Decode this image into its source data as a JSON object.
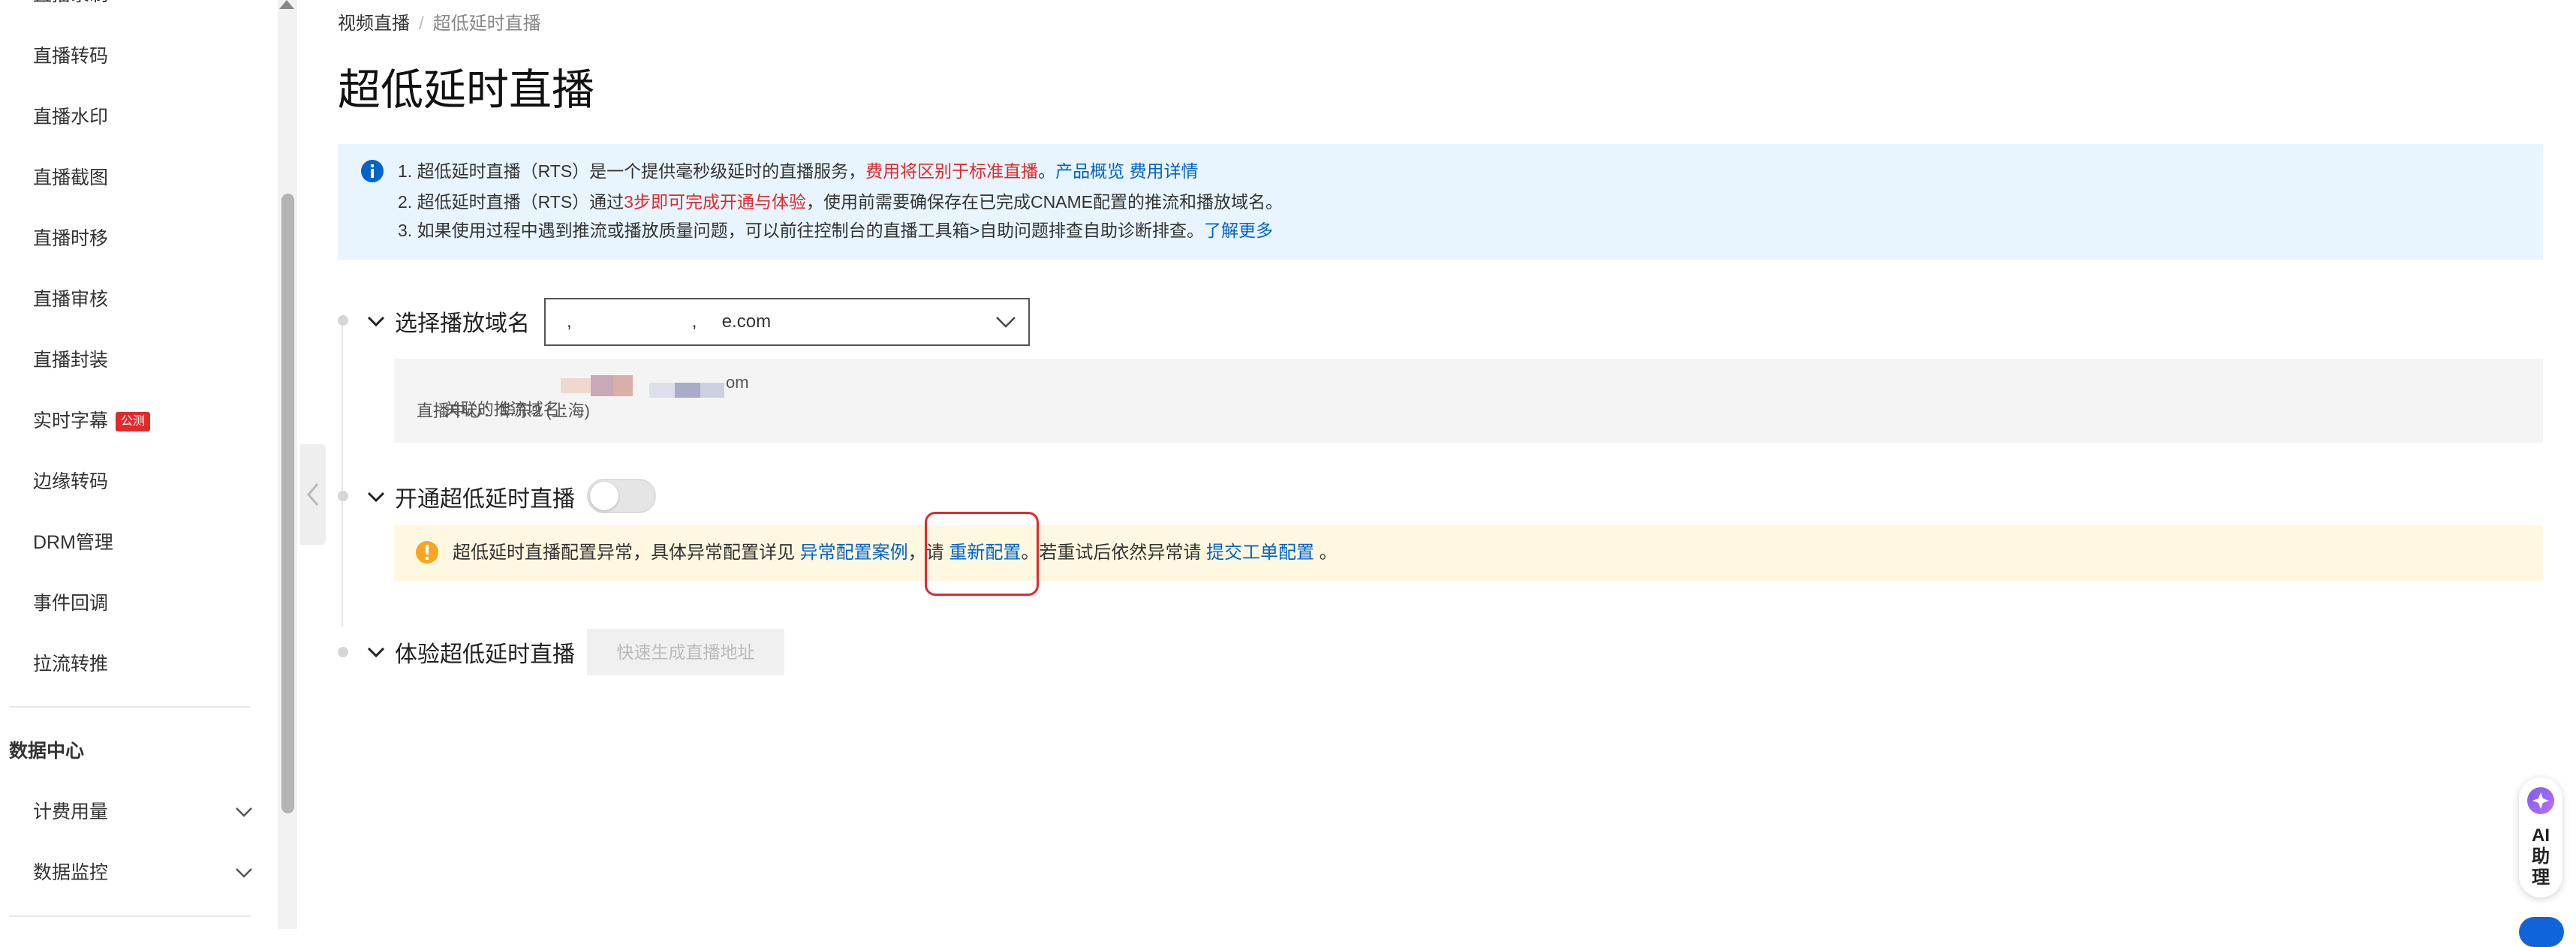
{
  "sidebar": {
    "clipped_item": "直播录制",
    "items": [
      {
        "label": "直播转码"
      },
      {
        "label": "直播水印"
      },
      {
        "label": "直播截图"
      },
      {
        "label": "直播时移"
      },
      {
        "label": "直播审核"
      },
      {
        "label": "直播封装"
      },
      {
        "label": "实时字幕",
        "badge": "公测"
      },
      {
        "label": "边缘转码"
      },
      {
        "label": "DRM管理"
      },
      {
        "label": "事件回调"
      },
      {
        "label": "拉流转推"
      }
    ],
    "group_title": "数据中心",
    "group_items": [
      {
        "label": "计费用量"
      },
      {
        "label": "数据监控"
      }
    ]
  },
  "breadcrumb": {
    "parent": "视频直播",
    "separator": "/",
    "current": "超低延时直播"
  },
  "page_title": "超低延时直播",
  "info": {
    "line1": {
      "text": "1. 超低延时直播（RTS）是一个提供毫秒级延时的直播服务，",
      "red": "费用将区别于标准直播",
      "sep": "。",
      "link1": "产品概览",
      "link2": "费用详情"
    },
    "line2": {
      "pre": "2. 超低延时直播（RTS）通过",
      "red": "3步即可完成开通与体验",
      "post": "，使用前需要确保存在已完成CNAME配置的推流和播放域名。"
    },
    "line3": {
      "text": "3. 如果使用过程中遇到推流或播放质量问题，可以前往控制台的直播工具箱>自助问题排查自助诊断排查。",
      "link": "了解更多"
    }
  },
  "step1": {
    "title": "选择播放域名",
    "select_value": ",                        ,     e.com",
    "push_label": "关联的推流域名：",
    "push_suffix": "om",
    "region_label": "直播中心：华东2 (上海)"
  },
  "step2": {
    "title": "开通超低延时直播",
    "toggle_on": false,
    "warning": {
      "text1": "超低延时直播配置异常，具体异常配置详见 ",
      "link1": "异常配置案例",
      "text2": "，请 ",
      "link2": "重新配置",
      "text3": "。若重试后依然异常请 ",
      "link3": "提交工单配置",
      "text4": " 。"
    }
  },
  "step3": {
    "title": "体验超低延时直播",
    "button": "快速生成直播地址"
  },
  "ai_helper": {
    "label_line1": "AI",
    "label_line2": "助",
    "label_line3": "理"
  },
  "colors": {
    "link": "#0064c8",
    "red": "#e0292b",
    "info_bg": "#e8f4fe",
    "warn_bg": "#fff8e1",
    "warn_icon": "#f5a623"
  }
}
